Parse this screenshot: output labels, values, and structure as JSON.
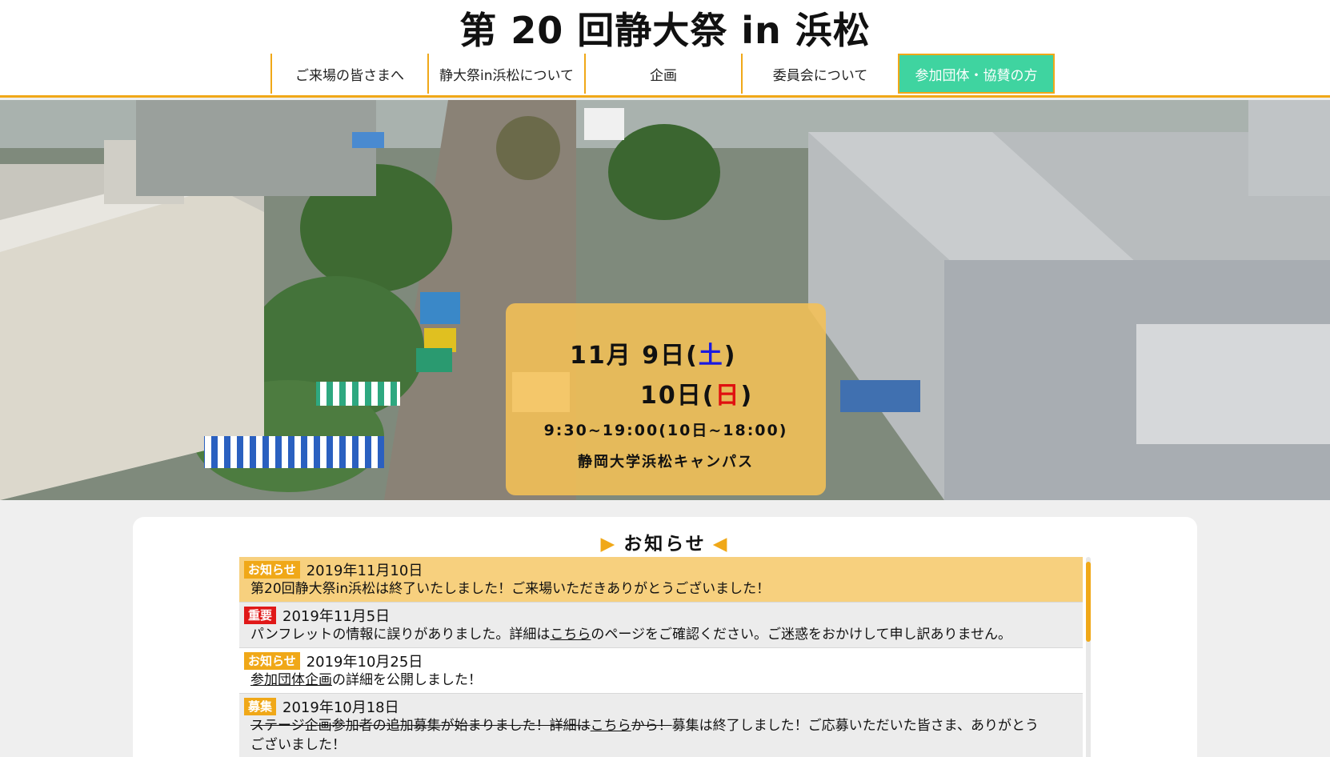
{
  "site": {
    "title": "第 20 回静大祭 in 浜松"
  },
  "nav": {
    "items": [
      {
        "label": "ご来場の皆さまへ"
      },
      {
        "label": "静大祭in浜松について"
      },
      {
        "label": "企画"
      },
      {
        "label": "委員会について"
      },
      {
        "label": "参加団体・協賛の方"
      }
    ],
    "active_color": "#3fd4a0",
    "accent_color": "#f0a818"
  },
  "hero": {
    "date1_prefix": "11月  9日(",
    "date1_day": "土",
    "date1_suffix": ")",
    "date2_prefix": "10日(",
    "date2_day": "日",
    "date2_suffix": ")",
    "time": "9:30~19:00(10日~18:00)",
    "venue": "静岡大学浜松キャンパス"
  },
  "news": {
    "heading": "お知らせ",
    "items": [
      {
        "badge": "お知らせ",
        "date": "2019年11月10日",
        "text": "第20回静大祭in浜松は終了いたしました！ご来場いただきありがとうございました！"
      },
      {
        "badge": "重要",
        "date": "2019年11月5日",
        "text_before": "パンフレットの情報に誤りがありました。詳細は",
        "link": "こちら",
        "text_after": "のページをご確認ください。ご迷惑をおかけして申し訳ありません。"
      },
      {
        "badge": "お知らせ",
        "date": "2019年10月25日",
        "link": "参加団体企画",
        "text_after": "の詳細を公開しました！"
      },
      {
        "badge": "募集",
        "date": "2019年10月18日",
        "strike_before": "ステージ企画参加者の追加募集が始まりました！詳細は",
        "link": "こちら",
        "strike_after": "から！",
        "text_after": "募集は終了しました！ご応募いただいた皆さま、ありがとう",
        "text_line2": "ございました！"
      }
    ]
  }
}
